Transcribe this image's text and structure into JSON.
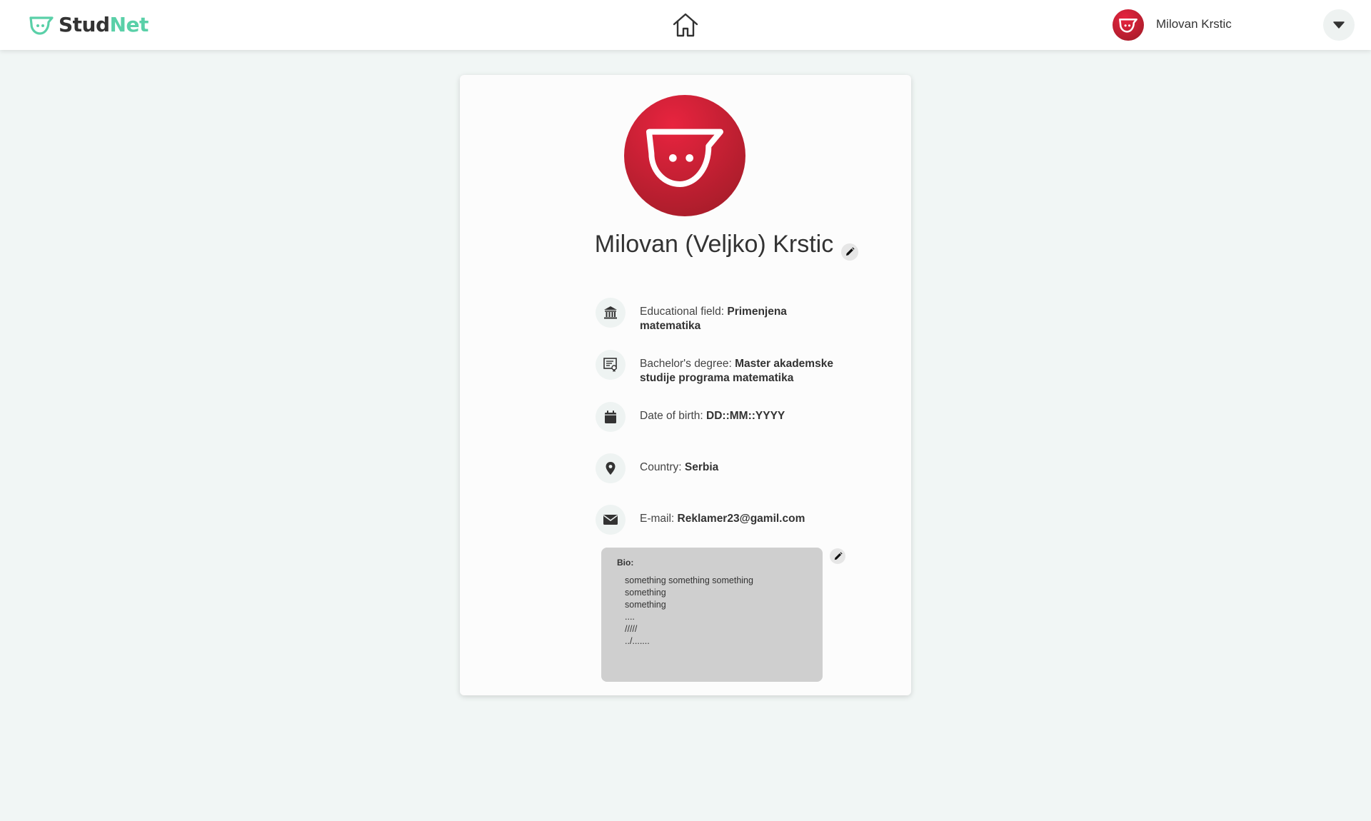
{
  "app": {
    "logo_part1": "Stud",
    "logo_part2": "Net",
    "brand_color": "#5ad0a8",
    "accent_color": "#d72032"
  },
  "header": {
    "home_icon": "home-icon",
    "user_name": "Milovan Krstic",
    "dropdown_icon": "caret-down-icon"
  },
  "profile": {
    "full_name": "Milovan (Veljko) Krstic",
    "fields": [
      {
        "icon": "bank-icon",
        "label": "Educational field: ",
        "value": "Primenjena matematika"
      },
      {
        "icon": "certificate-icon",
        "label": "Bachelor's degree: ",
        "value": "Master  akademske studije programa matematika"
      },
      {
        "icon": "calendar-icon",
        "label": "Date of birth: ",
        "value": "DD::MM::YYYY"
      },
      {
        "icon": "location-pin-icon",
        "label": "Country: ",
        "value": "Serbia"
      },
      {
        "icon": "envelope-icon",
        "label": "E-mail: ",
        "value": "Reklamer23@gamil.com"
      }
    ],
    "bio": {
      "title": "Bio:",
      "lines": [
        "something something something",
        "something",
        "something",
        "....",
        "/////",
        "../......."
      ]
    }
  }
}
